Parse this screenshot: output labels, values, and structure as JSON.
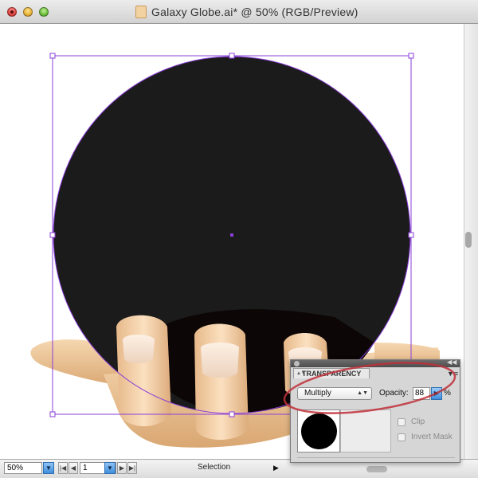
{
  "window": {
    "title": "Galaxy Globe.ai* @ 50% (RGB/Preview)"
  },
  "statusbar": {
    "zoom": "50%",
    "page": "1",
    "tool": "Selection"
  },
  "transparency_panel": {
    "tab_label": "TRANSPARENCY",
    "blend_mode": "Multiply",
    "opacity_label": "Opacity:",
    "opacity_value": "88",
    "opacity_unit": "%",
    "clip_label": "Clip",
    "invert_mask_label": "Invert Mask",
    "clip_checked": false,
    "invert_mask_checked": false
  },
  "colors": {
    "selection": "#8a3fd8",
    "circle_fill": "#1c1b1c",
    "annotation": "#c0303a"
  }
}
